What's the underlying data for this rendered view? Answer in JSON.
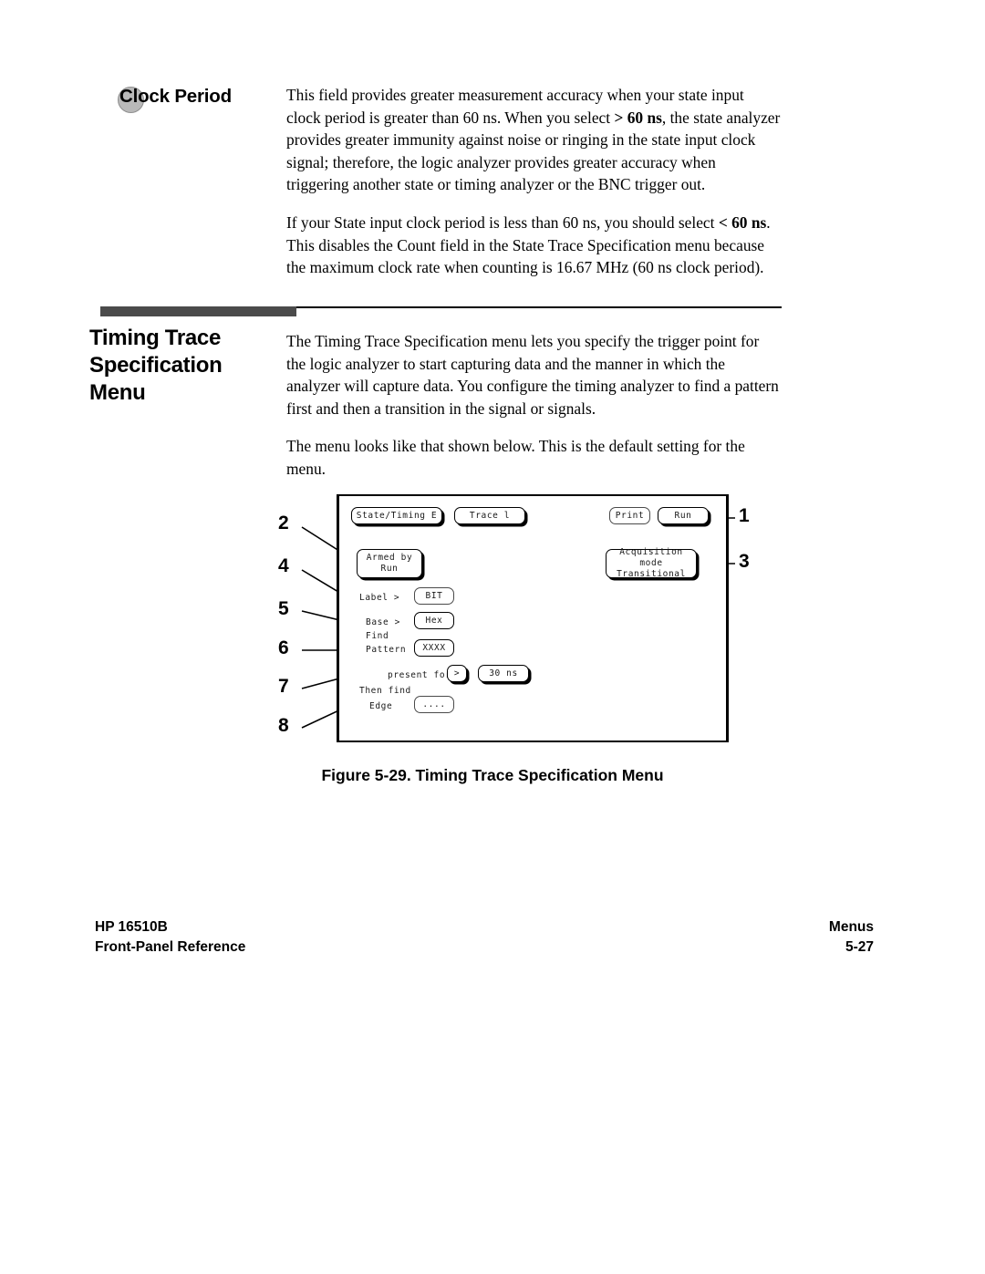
{
  "clock_period": {
    "term": "Clock Period",
    "bullet_color": "#b9b9b9",
    "paragraph_1_a": "This field provides greater measurement accuracy when your state input clock period is greater than 60 ns. When you select ",
    "paragraph_1_bold": "> 60 ns",
    "paragraph_1_b": ", the state analyzer provides greater immunity against noise or ringing in the state input clock signal; therefore, the logic analyzer provides greater accuracy when triggering another state or timing analyzer or the BNC trigger out.",
    "paragraph_2_a": "If your  State input clock period is less than 60 ns, you should select ",
    "paragraph_2_bold": "< 60 ns",
    "paragraph_2_b": ". This disables the Count field in the State Trace Specification menu because the maximum clock rate when counting is 16.67 MHz (60 ns clock period)."
  },
  "section": {
    "heading": "Timing Trace Specification Menu",
    "paragraph_1": "The Timing Trace Specification menu lets you specify the trigger point for the logic analyzer to start capturing data and the manner in which the analyzer will capture data. You configure the timing analyzer to find a pattern first and then a transition in the signal or signals.",
    "paragraph_2": "The menu looks like that shown below. This is the default setting for the menu."
  },
  "figure": {
    "caption": "Figure 5-29. Timing Trace Specification Menu",
    "screen": {
      "state_timing_button": "State/Timing E",
      "trace_button": "Trace l",
      "print_button": "Print",
      "run_button": "Run",
      "armed_by_label": "Armed by",
      "armed_by_value": "Run",
      "acquisition_mode_label": "Acquisition mode",
      "acquisition_mode_value": "Transitional",
      "label_field_label": "Label >",
      "label_field_value": "BIT",
      "base_field_label": "Base >",
      "base_field_value": "Hex",
      "find_text": "Find",
      "pattern_field_label": "Pattern",
      "pattern_field_value": "XXXX",
      "present_for_label": "present for",
      "present_for_operator": ">",
      "present_for_value": "30 ns",
      "then_find_text": "Then find",
      "edge_field_label": "Edge",
      "edge_field_value": "...."
    },
    "callouts": {
      "c1": "1",
      "c2": "2",
      "c3": "3",
      "c4": "4",
      "c5": "5",
      "c6": "6",
      "c7": "7",
      "c8": "8"
    }
  },
  "footer": {
    "left_line_1": "HP 16510B",
    "left_line_2": "Front-Panel Reference",
    "right_line_1": "Menus",
    "right_line_2": "5-27"
  }
}
